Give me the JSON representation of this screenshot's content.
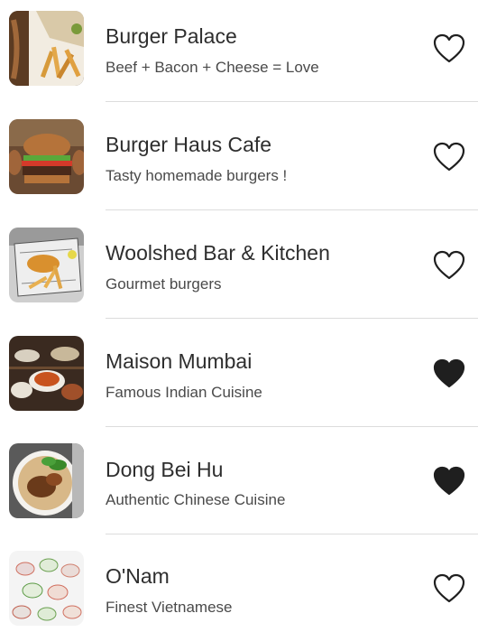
{
  "restaurants": [
    {
      "name": "Burger Palace",
      "tagline": "Beef + Bacon + Cheese = Love",
      "favorite": false,
      "image_icon": "fries-sandwich-image"
    },
    {
      "name": "Burger Haus Cafe",
      "tagline": "Tasty homemade burgers !",
      "favorite": false,
      "image_icon": "burger-image"
    },
    {
      "name": "Woolshed Bar & Kitchen",
      "tagline": "Gourmet burgers",
      "favorite": false,
      "image_icon": "fish-and-chips-image"
    },
    {
      "name": "Maison Mumbai",
      "tagline": "Famous Indian Cuisine",
      "favorite": true,
      "image_icon": "indian-dishes-image"
    },
    {
      "name": "Dong Bei Hu",
      "tagline": "Authentic Chinese Cuisine",
      "favorite": true,
      "image_icon": "chinese-rice-bowl-image"
    },
    {
      "name": "O'Nam",
      "tagline": "Finest Vietnamese",
      "favorite": false,
      "image_icon": "spring-rolls-image"
    }
  ],
  "colors": {
    "heart": "#1f1f1f",
    "title": "#2e2e2e",
    "subtitle": "#4a4a4a",
    "divider": "#dcdcdc"
  }
}
